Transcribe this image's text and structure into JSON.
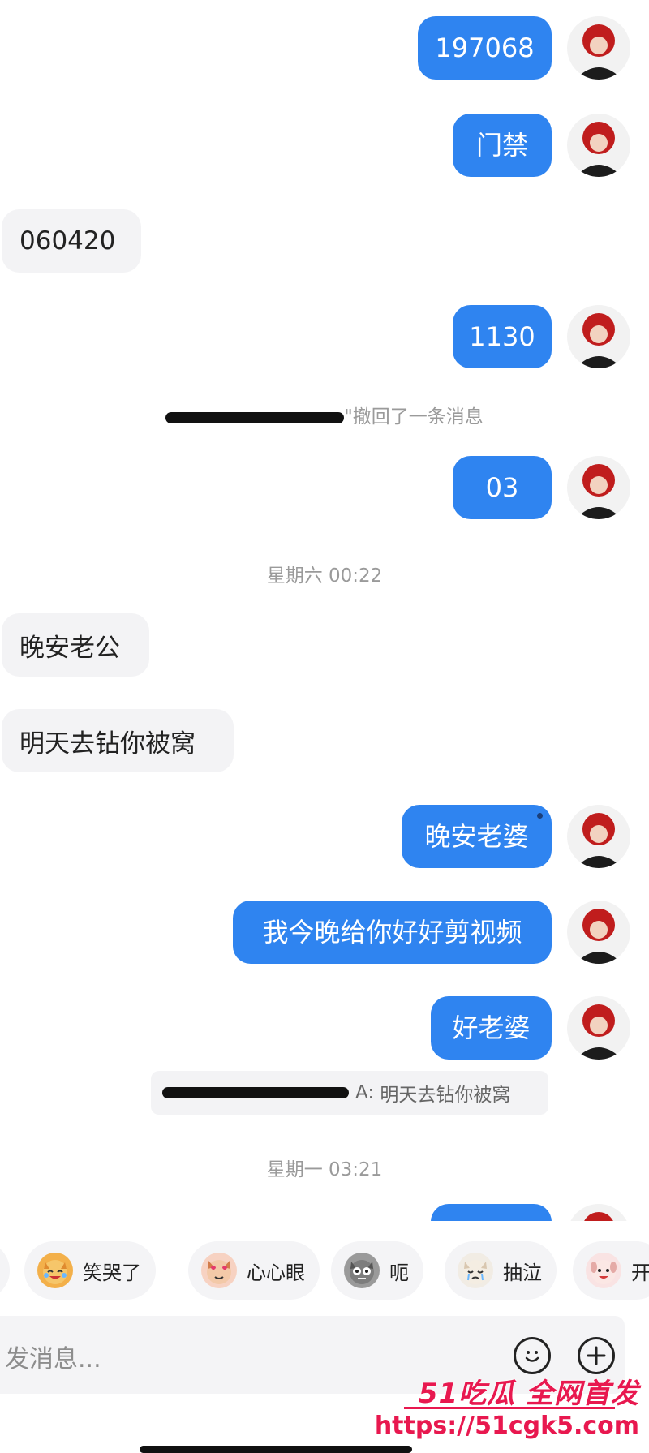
{
  "messages": [
    {
      "dir": "out",
      "text": "197068"
    },
    {
      "dir": "out",
      "text": "门禁"
    },
    {
      "dir": "in",
      "text": "060420"
    },
    {
      "dir": "out",
      "text": "1130"
    },
    {
      "dir": "out",
      "text": "03"
    },
    {
      "dir": "in",
      "text": "晚安老公"
    },
    {
      "dir": "in",
      "text": "明天去钻你被窝"
    },
    {
      "dir": "out",
      "text": "晚安老婆"
    },
    {
      "dir": "out",
      "text": "我今晚给你好好剪视频"
    },
    {
      "dir": "out",
      "text": "好老婆"
    }
  ],
  "recall_notice": {
    "text": "\"撤回了一条消息"
  },
  "quote_reply": {
    "text": "明天去钻你被窝"
  },
  "timestamps": [
    "星期六 00:22",
    "星期一 03:21"
  ],
  "emoji_suggestions": [
    {
      "label": "笑哭了",
      "icon": "laughing-cat-face"
    },
    {
      "label": "心心眼",
      "icon": "heart-eyes-dog-face"
    },
    {
      "label": "呃",
      "icon": "awkward-cat-face"
    },
    {
      "label": "抽泣",
      "icon": "sobbing-cat-face"
    },
    {
      "label": "开",
      "icon": "happy-dog-face"
    }
  ],
  "input": {
    "placeholder": "发消息..."
  },
  "watermark": {
    "logo": "51吃瓜 全网首发",
    "url": "https://51cgk5.com"
  },
  "colors": {
    "outgoing_bubble": "#2f84f0",
    "incoming_bubble": "#f3f3f5",
    "watermark": "#e8184f"
  }
}
